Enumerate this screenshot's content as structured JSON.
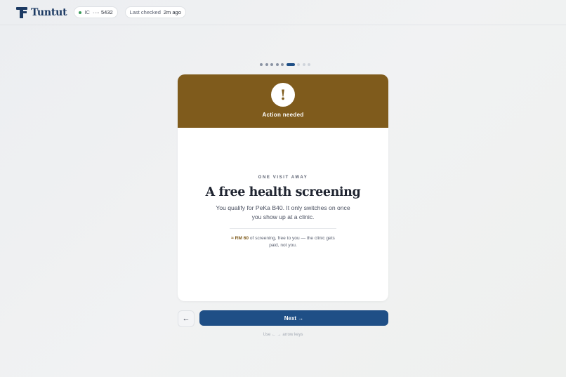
{
  "header": {
    "brand": "Tuntut",
    "ic_label": "IC",
    "ic_value": "···· 5432",
    "last_checked_label": "Last checked",
    "last_checked_value": "2m ago"
  },
  "progress": {
    "total": 9,
    "current": 6
  },
  "card": {
    "status_label": "Action needed",
    "status_icon": "!",
    "eyebrow": "ONE VISIT AWAY",
    "title": "A free health screening",
    "description": "You qualify for PeKa B40. It only switches on once you show up at a clinic.",
    "note_amount": "≈ RM 60",
    "note_text": " of screening, free to you — the clinic gets paid, not you."
  },
  "nav": {
    "back_label": "←",
    "next_label": "Next →",
    "hint": "Use ← → arrow keys"
  },
  "colors": {
    "brand": "#1c3a63",
    "accent": "#1f4f86",
    "warning": "#7f5b1c"
  }
}
